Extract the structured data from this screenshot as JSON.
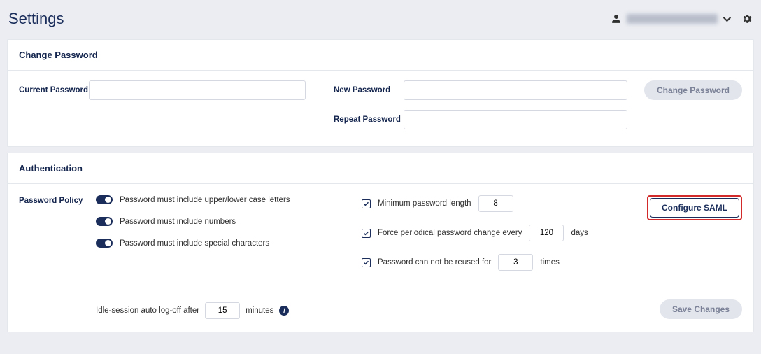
{
  "header": {
    "title": "Settings",
    "user_email": "[redacted]"
  },
  "change_pwd": {
    "title": "Change Password",
    "current_label": "Current Password",
    "new_label": "New Password",
    "repeat_label": "Repeat Password",
    "button": "Change Password",
    "current_value": "",
    "new_value": "",
    "repeat_value": ""
  },
  "auth": {
    "title": "Authentication",
    "policy_label": "Password Policy",
    "toggle_upper_lower": "Password must include upper/lower case letters",
    "toggle_numbers": "Password must include numbers",
    "toggle_special": "Password must include special characters",
    "min_len_label": "Minimum password length",
    "min_len_value": "8",
    "force_change_label": "Force periodical password change every",
    "force_change_value": "120",
    "days_suffix": "days",
    "reuse_label": "Password can not be reused for",
    "reuse_value": "3",
    "times_suffix": "times",
    "idle_label": "Idle-session auto log-off after",
    "idle_value": "15",
    "minutes_suffix": "minutes",
    "configure_saml_btn": "Configure SAML",
    "save_btn": "Save Changes"
  }
}
